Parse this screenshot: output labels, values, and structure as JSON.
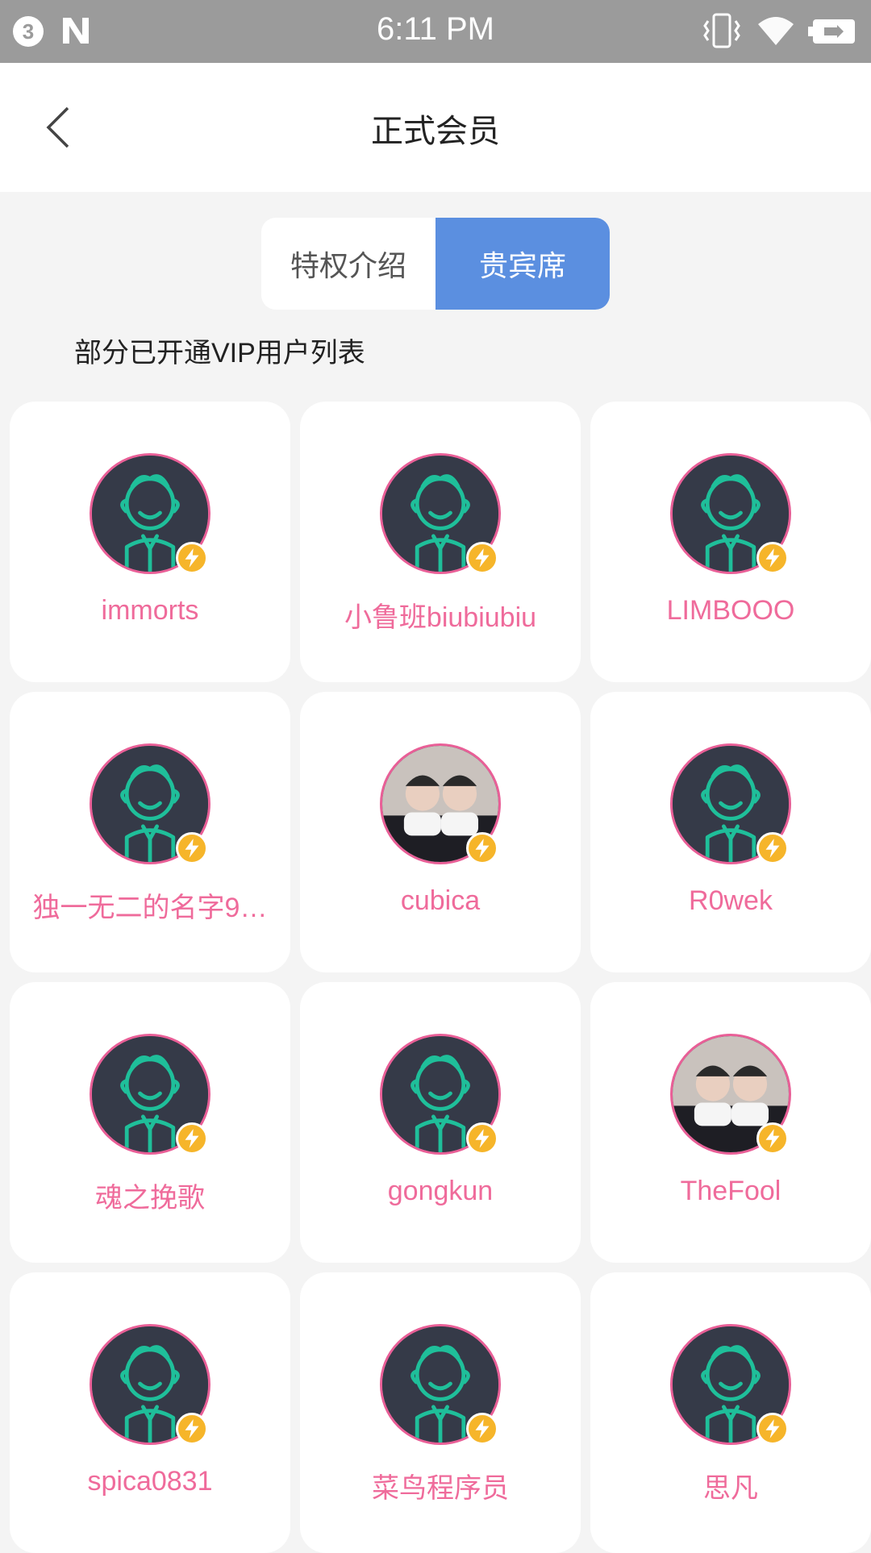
{
  "status_bar": {
    "notification_count": "3",
    "time": "6:11 PM"
  },
  "header": {
    "title": "正式会员"
  },
  "tabs": [
    {
      "label": "特权介绍",
      "active": false
    },
    {
      "label": "贵宾席",
      "active": true
    }
  ],
  "section_label": "部分已开通VIP用户列表",
  "colors": {
    "accent": "#5b8fe0",
    "name_pink": "#ef6b9b",
    "avatar_ring": "#e95f97",
    "avatar_bg": "#353a48",
    "avatar_figure": "#1fbf9a",
    "vip_badge": "#f6b52a"
  },
  "members": [
    {
      "name": "immorts",
      "avatar": "default-avatar"
    },
    {
      "name": "小鲁班biubiubiu",
      "avatar": "default-avatar"
    },
    {
      "name": "LIMBOOO",
      "avatar": "default-avatar"
    },
    {
      "name": "独一无二的名字9…",
      "avatar": "default-avatar"
    },
    {
      "name": "cubica",
      "avatar": "photo-avatar"
    },
    {
      "name": "R0wek",
      "avatar": "default-avatar"
    },
    {
      "name": "魂之挽歌",
      "avatar": "default-avatar"
    },
    {
      "name": "gongkun",
      "avatar": "default-avatar"
    },
    {
      "name": "TheFool",
      "avatar": "photo-avatar"
    },
    {
      "name": "spica0831",
      "avatar": "default-avatar"
    },
    {
      "name": "菜鸟程序员",
      "avatar": "default-avatar"
    },
    {
      "name": "思凡",
      "avatar": "default-avatar"
    }
  ]
}
